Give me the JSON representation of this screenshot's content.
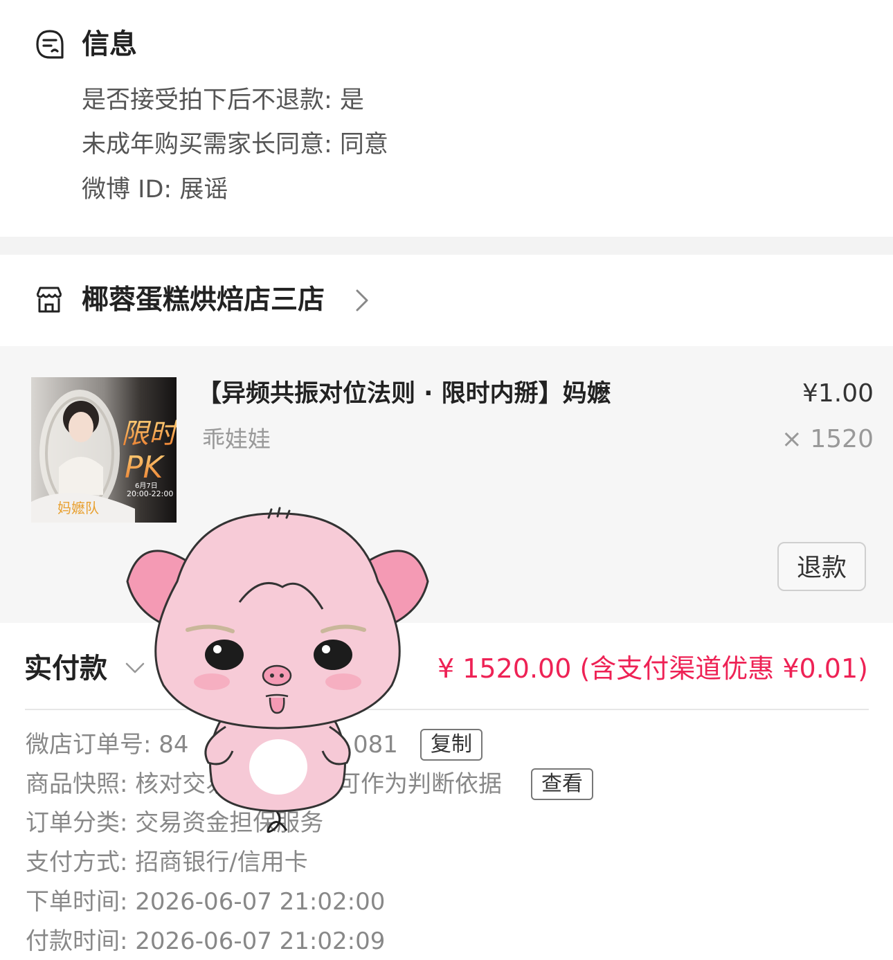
{
  "info": {
    "title": "信息",
    "lines": [
      "是否接受拍下后不退款: 是",
      "未成年购买需家长同意: 同意",
      "微博 ID: 展谣"
    ]
  },
  "shop": {
    "name": "椰蓉蛋糕烘焙店三店"
  },
  "product": {
    "title": "【异频共振对位法则 · 限时内掰】妈嬷",
    "seller": "乖娃娃",
    "price": "¥1.00",
    "quantity": "× 1520",
    "refund_label": "退款",
    "thumb_text": {
      "big1": "限时",
      "big2": "PK",
      "date": "6月7日",
      "time": "20:00-22:00",
      "team": "妈嬷队"
    }
  },
  "payment": {
    "label": "实付款",
    "amount": "¥ 1520.00 (含支付渠道优惠 ¥0.01)"
  },
  "details": {
    "order_no": "微店订单号:  84",
    "order_no_tail": "081",
    "copy_label": "复制",
    "snapshot": "商品快照: 核对交易",
    "snapshot_tail": "可作为判断依据",
    "view_label": "查看",
    "category": "订单分类:  交易资金担保服务",
    "pay_method": "支付方式:  招商银行/信用卡",
    "order_time": "下单时间:  2026-06-07 21:02:00",
    "pay_time": "付款时间:  2026-06-07 21:02:09"
  },
  "colors": {
    "accent_red": "#ee2255",
    "card_bg": "#f6f6f6",
    "sticker_pink": "#f6c9d6"
  },
  "icons": [
    "message-icon",
    "shop-icon",
    "chevron-right-icon",
    "chevron-down-icon",
    "pig-sticker"
  ]
}
